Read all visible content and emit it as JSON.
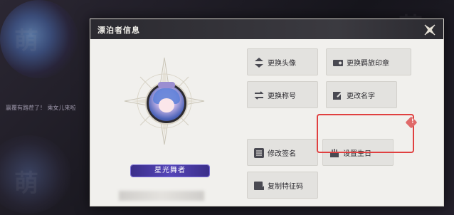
{
  "dialog": {
    "title": "漂泊者信息"
  },
  "profile": {
    "name": "星光舞者"
  },
  "buttons": {
    "change_avatar": "更换头像",
    "change_stamp": "更换羁旅印章",
    "change_title": "更换称号",
    "change_name": "更改名字",
    "change_signature": "修改签名",
    "set_birthday": "设置生日",
    "copy_code": "复制特征码"
  },
  "badge": {
    "new_marker": "!"
  },
  "colors": {
    "highlight_border": "#e04040",
    "nameplate_bg": "#4a3ca6",
    "dialog_header": "#2f2e34"
  },
  "background": {
    "chat_line": "赢覆有路茬了！ 乘女儿来啦"
  },
  "icons": {
    "close": "close-x-icon",
    "avatar": "avatar-swap-icon",
    "stamp": "stamp-icon",
    "title": "swap-arrows-icon",
    "name": "edit-pen-icon",
    "signature": "list-lines-icon",
    "birthday": "cake-icon",
    "copy": "copy-stamp-icon"
  }
}
